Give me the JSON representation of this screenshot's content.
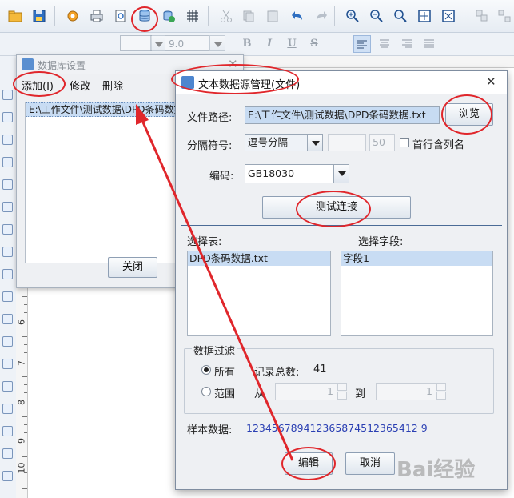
{
  "toolbar": {
    "icons": [
      "open-folder-icon",
      "save-icon",
      "settings-icon",
      "print-icon",
      "print-preview-icon",
      "database-icon",
      "database-add-icon",
      "grid-icon",
      "cut-icon",
      "copy-icon",
      "paste-icon",
      "undo-icon",
      "redo-icon",
      "zoom-in-icon",
      "zoom-out-icon",
      "zoom-fit-icon",
      "fit-page-icon",
      "actual-size-icon",
      "group-icon",
      "ungroup-icon"
    ]
  },
  "formatbar": {
    "font_size": "9.0",
    "bold": "B",
    "italic": "I",
    "underline": "U",
    "strike": "S"
  },
  "ruler": {
    "numbers": [
      "6",
      "7",
      "8",
      "9",
      "10"
    ]
  },
  "db_settings": {
    "title": "数据库设置",
    "menu": [
      "添加(I)",
      "修改",
      "删除"
    ],
    "list_item": "E:\\工作文件\\测试数据\\DPD条码数据.txt",
    "close_button": "关闭"
  },
  "text_source": {
    "title": "文本数据源管理(文件)",
    "path_label": "文件路径:",
    "path_value": "E:\\工作文件\\测试数据\\DPD条码数据.txt",
    "browse_button": "浏览",
    "separator_label": "分隔符号:",
    "separator_value": "逗号分隔",
    "separator_number": "50",
    "first_row_label": "首行含列名",
    "encoding_label": "编码:",
    "encoding_value": "GB18030",
    "test_button": "测试连接",
    "table_label": "选择表:",
    "table_item": "DPD条码数据.txt",
    "field_label": "选择字段:",
    "field_item": "字段1",
    "filter_title": "数据过滤",
    "radio_all": "所有",
    "total_label": "记录总数:",
    "total_value": "41",
    "radio_range": "范围",
    "from_label": "从",
    "from_value": "1",
    "to_label": "到",
    "to_value": "1",
    "sample_label": "样本数据:",
    "sample_value": "123456789412365874512365412 9",
    "edit_button": "编辑",
    "cancel_button": "取消"
  },
  "watermark": "Bai经验"
}
